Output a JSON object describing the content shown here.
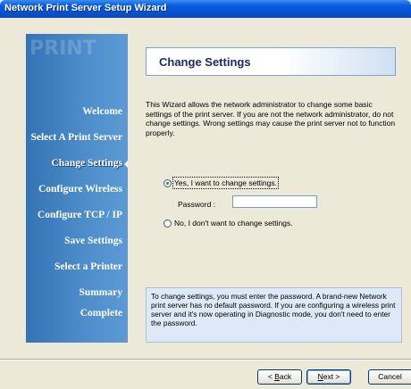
{
  "window": {
    "title": "Network Print Server Setup Wizard"
  },
  "sidebar": {
    "watermark": "PRINT",
    "steps": [
      {
        "label": "Welcome"
      },
      {
        "label": "Select A Print Server"
      },
      {
        "label": "Change Settings",
        "active": true
      },
      {
        "label": "Configure Wireless"
      },
      {
        "label": "Configure TCP / IP"
      },
      {
        "label": "Save Settings"
      },
      {
        "label": "Select a Printer"
      },
      {
        "label": "Summary"
      },
      {
        "label": "Complete"
      }
    ]
  },
  "header": {
    "title": "Change Settings"
  },
  "description": "This Wizard allows the network administrator to change some basic settings of the print server. If you are not the network administrator, do not change settings. Wrong settings may cause the print server not to function properly.",
  "options": {
    "yes_label": "Yes, I want to change settings.",
    "no_label": "No, I don't want to change settings.",
    "selected": "yes"
  },
  "password": {
    "label": "Password :",
    "value": ""
  },
  "info": "To change settings, you must enter the password. A brand-new Network print server has no default password. If you are configuring a wireless print server and it's now operating in Diagnostic mode, you don't need to enter the password.",
  "buttons": {
    "back_prefix": "< ",
    "back_underline": "B",
    "back_rest": "ack",
    "next_underline": "N",
    "next_rest": "ext >",
    "cancel": "Cancel"
  },
  "colors": {
    "sidebar": "#4e8ecb",
    "titlebar": "#0555d6",
    "header_text": "#1a2a6c"
  }
}
